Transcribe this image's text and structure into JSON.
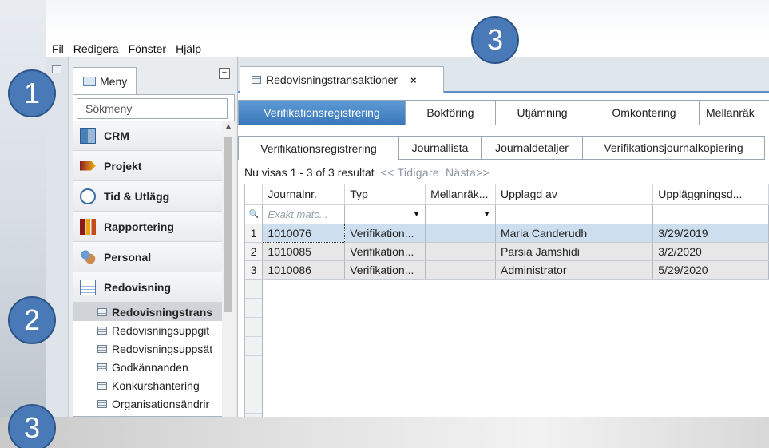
{
  "menubar": [
    "Fil",
    "Redigera",
    "Fönster",
    "Hjälp"
  ],
  "left_panel": {
    "tab_label": "Meny",
    "collapse_symbol": "−",
    "search_placeholder": "Sökmeny",
    "categories": [
      {
        "label": "CRM",
        "icon": "crm-icon"
      },
      {
        "label": "Projekt",
        "icon": "project-icon"
      },
      {
        "label": "Tid & Utlägg",
        "icon": "clock-icon"
      },
      {
        "label": "Rapportering",
        "icon": "chart-icon"
      },
      {
        "label": "Personal",
        "icon": "people-icon"
      },
      {
        "label": "Redovisning",
        "icon": "ledger-icon"
      }
    ],
    "sub_items": [
      "Redovisningstrans",
      "Redovisningsuppgit",
      "Redovisningsuppsät",
      "Godkännanden",
      "Konkurshantering",
      "Organisationsändrir"
    ]
  },
  "main": {
    "doc_tab": {
      "label": "Redovisningstransaktioner",
      "close": "×"
    },
    "level1_tabs": [
      "Verifikationsregistrering",
      "Bokföring",
      "Utjämning",
      "Omkontering",
      "Mellanräk"
    ],
    "level2_tabs": [
      "Verifikationsregistrering",
      "Journallista",
      "Journaldetaljer",
      "Verifikationsjournalkopiering"
    ],
    "pager": {
      "text": "Nu visas 1 - 3 of 3 resultat",
      "prev": "<< Tidigare",
      "next": "Nästa>>"
    },
    "grid": {
      "columns": [
        "Journalnr.",
        "Typ",
        "Mellanräk...",
        "Upplagd av",
        "Uppläggningsd..."
      ],
      "filter_placeholder": "Exakt matc...",
      "rows": [
        {
          "n": "1",
          "journal": "1010076",
          "typ": "Verifikation...",
          "mellan": "",
          "upplagd": "Maria Canderudh",
          "datum": "3/29/2019"
        },
        {
          "n": "2",
          "journal": "1010085",
          "typ": "Verifikation...",
          "mellan": "",
          "upplagd": "Parsia Jamshidi",
          "datum": "3/2/2020"
        },
        {
          "n": "3",
          "journal": "1010086",
          "typ": "Verifikation...",
          "mellan": "",
          "upplagd": "Administrator",
          "datum": "5/29/2020"
        }
      ]
    }
  },
  "badges": [
    "1",
    "2",
    "3",
    "3"
  ]
}
